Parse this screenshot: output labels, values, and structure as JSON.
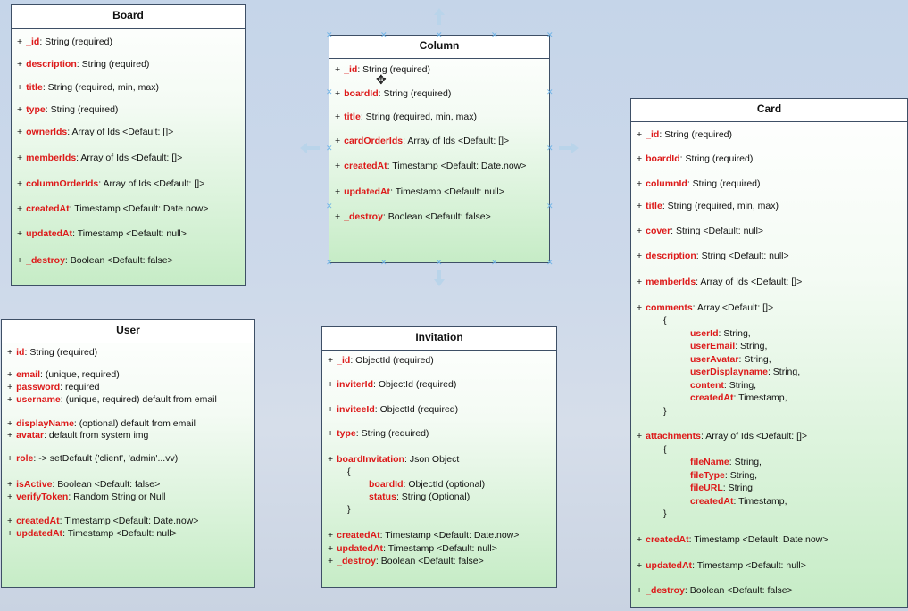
{
  "board": {
    "title": "Board",
    "fields": [
      {
        "plus": "+",
        "name": "_id",
        "rest": ": String (required)"
      },
      {
        "plus": "+",
        "name": "description",
        "rest": ": String (required)"
      },
      {
        "plus": "+",
        "name": "title",
        "rest": ": String (required, min, max)"
      },
      {
        "plus": "+",
        "name": "type",
        "rest": ": String (required)"
      },
      {
        "plus": "+",
        "name": "ownerIds",
        "rest": ": Array of Ids <Default: []>"
      },
      {
        "plus": "+",
        "name": "memberIds",
        "rest": ": Array of Ids <Default: []>"
      },
      {
        "plus": "+",
        "name": "columnOrderIds",
        "rest": ": Array of Ids <Default: []>"
      },
      {
        "plus": "+",
        "name": "createdAt",
        "rest": ": Timestamp <Default: Date.now>"
      },
      {
        "plus": "+",
        "name": "updatedAt",
        "rest": ": Timestamp <Default: null>"
      },
      {
        "plus": "+",
        "name": "_destroy",
        "rest": ": Boolean <Default: false>"
      }
    ]
  },
  "column": {
    "title": "Column",
    "fields": [
      {
        "plus": "+",
        "name": "_id",
        "rest": ": String (required)"
      },
      {
        "plus": "+",
        "name": "boardId",
        "rest": ": String (required)"
      },
      {
        "plus": "+",
        "name": "title",
        "rest": ": String (required, min, max)"
      },
      {
        "plus": "+",
        "name": "cardOrderIds",
        "rest": ": Array of Ids <Default: []>"
      },
      {
        "plus": "+",
        "name": "createdAt",
        "rest": ": Timestamp <Default: Date.now>"
      },
      {
        "plus": "+",
        "name": "updatedAt",
        "rest": ": Timestamp <Default: null>"
      },
      {
        "plus": "+",
        "name": "_destroy",
        "rest": ": Boolean <Default: false>"
      }
    ]
  },
  "card": {
    "title": "Card",
    "fields": [
      {
        "plus": "+",
        "name": "_id",
        "rest": ": String (required)"
      },
      {
        "plus": "+",
        "name": "boardId",
        "rest": ": String (required)"
      },
      {
        "plus": "+",
        "name": "columnId",
        "rest": ": String (required)"
      },
      {
        "plus": "+",
        "name": "title",
        "rest": ": String (required, min, max)"
      },
      {
        "plus": "+",
        "name": "cover",
        "rest": ": String <Default: null>"
      },
      {
        "plus": "+",
        "name": "description",
        "rest": ": String <Default: null>"
      },
      {
        "plus": "+",
        "name": "memberIds",
        "rest": ": Array of Ids <Default: []>"
      },
      {
        "plus": "+",
        "name": "comments",
        "rest": ": Array <Default: []>"
      },
      {
        "plus": "",
        "name": "",
        "rest": "{"
      },
      {
        "plus": "",
        "name": "userId",
        "rest": ": String,"
      },
      {
        "plus": "",
        "name": "userEmail",
        "rest": ": String,"
      },
      {
        "plus": "",
        "name": "userAvatar",
        "rest": ": String,"
      },
      {
        "plus": "",
        "name": "userDisplayname",
        "rest": ": String,"
      },
      {
        "plus": "",
        "name": "content",
        "rest": ": String,"
      },
      {
        "plus": "",
        "name": "createdAt",
        "rest": ": Timestamp,"
      },
      {
        "plus": "",
        "name": "",
        "rest": "}"
      },
      {
        "plus": "+",
        "name": "attachments",
        "rest": ": Array of Ids <Default: []>"
      },
      {
        "plus": "",
        "name": "",
        "rest": "{"
      },
      {
        "plus": "",
        "name": "fileName",
        "rest": ": String,"
      },
      {
        "plus": "",
        "name": "fileType",
        "rest": ": String,"
      },
      {
        "plus": "",
        "name": "fileURL",
        "rest": ": String,"
      },
      {
        "plus": "",
        "name": "createdAt",
        "rest": ": Timestamp,"
      },
      {
        "plus": "",
        "name": "",
        "rest": "}"
      },
      {
        "plus": "+",
        "name": "createdAt",
        "rest": ": Timestamp <Default: Date.now>"
      },
      {
        "plus": "+",
        "name": "updatedAt",
        "rest": ": Timestamp <Default: null>"
      },
      {
        "plus": "+",
        "name": "_destroy",
        "rest": ": Boolean <Default: false>"
      }
    ]
  },
  "user": {
    "title": "User",
    "fields": [
      {
        "plus": "+",
        "name": "id",
        "rest": ": String (required)"
      },
      {
        "plus": "+",
        "name": "email",
        "rest": ": (unique, required)"
      },
      {
        "plus": "+",
        "name": "password",
        "rest": ": required"
      },
      {
        "plus": "+",
        "name": "username",
        "rest": ": (unique, required) default from email"
      },
      {
        "plus": "+",
        "name": "displayName",
        "rest": ": (optional) default from email"
      },
      {
        "plus": "+",
        "name": "avatar",
        "rest": ": default from system img"
      },
      {
        "plus": "+",
        "name": "role",
        "rest": ": -> setDefault ('client', 'admin'...vv)"
      },
      {
        "plus": "+",
        "name": "isActive",
        "rest": ": Boolean <Default: false>"
      },
      {
        "plus": "+",
        "name": "verifyToken",
        "rest": ": Random String or Null"
      },
      {
        "plus": "+",
        "name": "createdAt",
        "rest": ": Timestamp <Default: Date.now>"
      },
      {
        "plus": "+",
        "name": "updatedAt",
        "rest": ": Timestamp <Default: null>"
      }
    ]
  },
  "invitation": {
    "title": "Invitation",
    "fields": [
      {
        "plus": "+",
        "name": "_id",
        "rest": ": ObjectId (required)"
      },
      {
        "plus": "+",
        "name": "inviterId",
        "rest": ": ObjectId (required)"
      },
      {
        "plus": "+",
        "name": "inviteeId",
        "rest": ": ObjectId (required)"
      },
      {
        "plus": "+",
        "name": "type",
        "rest": ": String (required)"
      },
      {
        "plus": "+",
        "name": "boardInvitation",
        "rest": ": Json Object"
      },
      {
        "plus": "",
        "name": "",
        "rest": "{"
      },
      {
        "plus": "",
        "name": "boardId",
        "rest": ": ObjectId (optional)"
      },
      {
        "plus": "",
        "name": "status",
        "rest": ": String (Optional)"
      },
      {
        "plus": "",
        "name": "",
        "rest": "}"
      },
      {
        "plus": "+",
        "name": "createdAt",
        "rest": ": Timestamp <Default: Date.now>"
      },
      {
        "plus": "+",
        "name": "updatedAt",
        "rest": ": Timestamp <Default: null>"
      },
      {
        "plus": "+",
        "name": "_destroy",
        "rest": ": Boolean <Default: false>"
      }
    ]
  }
}
